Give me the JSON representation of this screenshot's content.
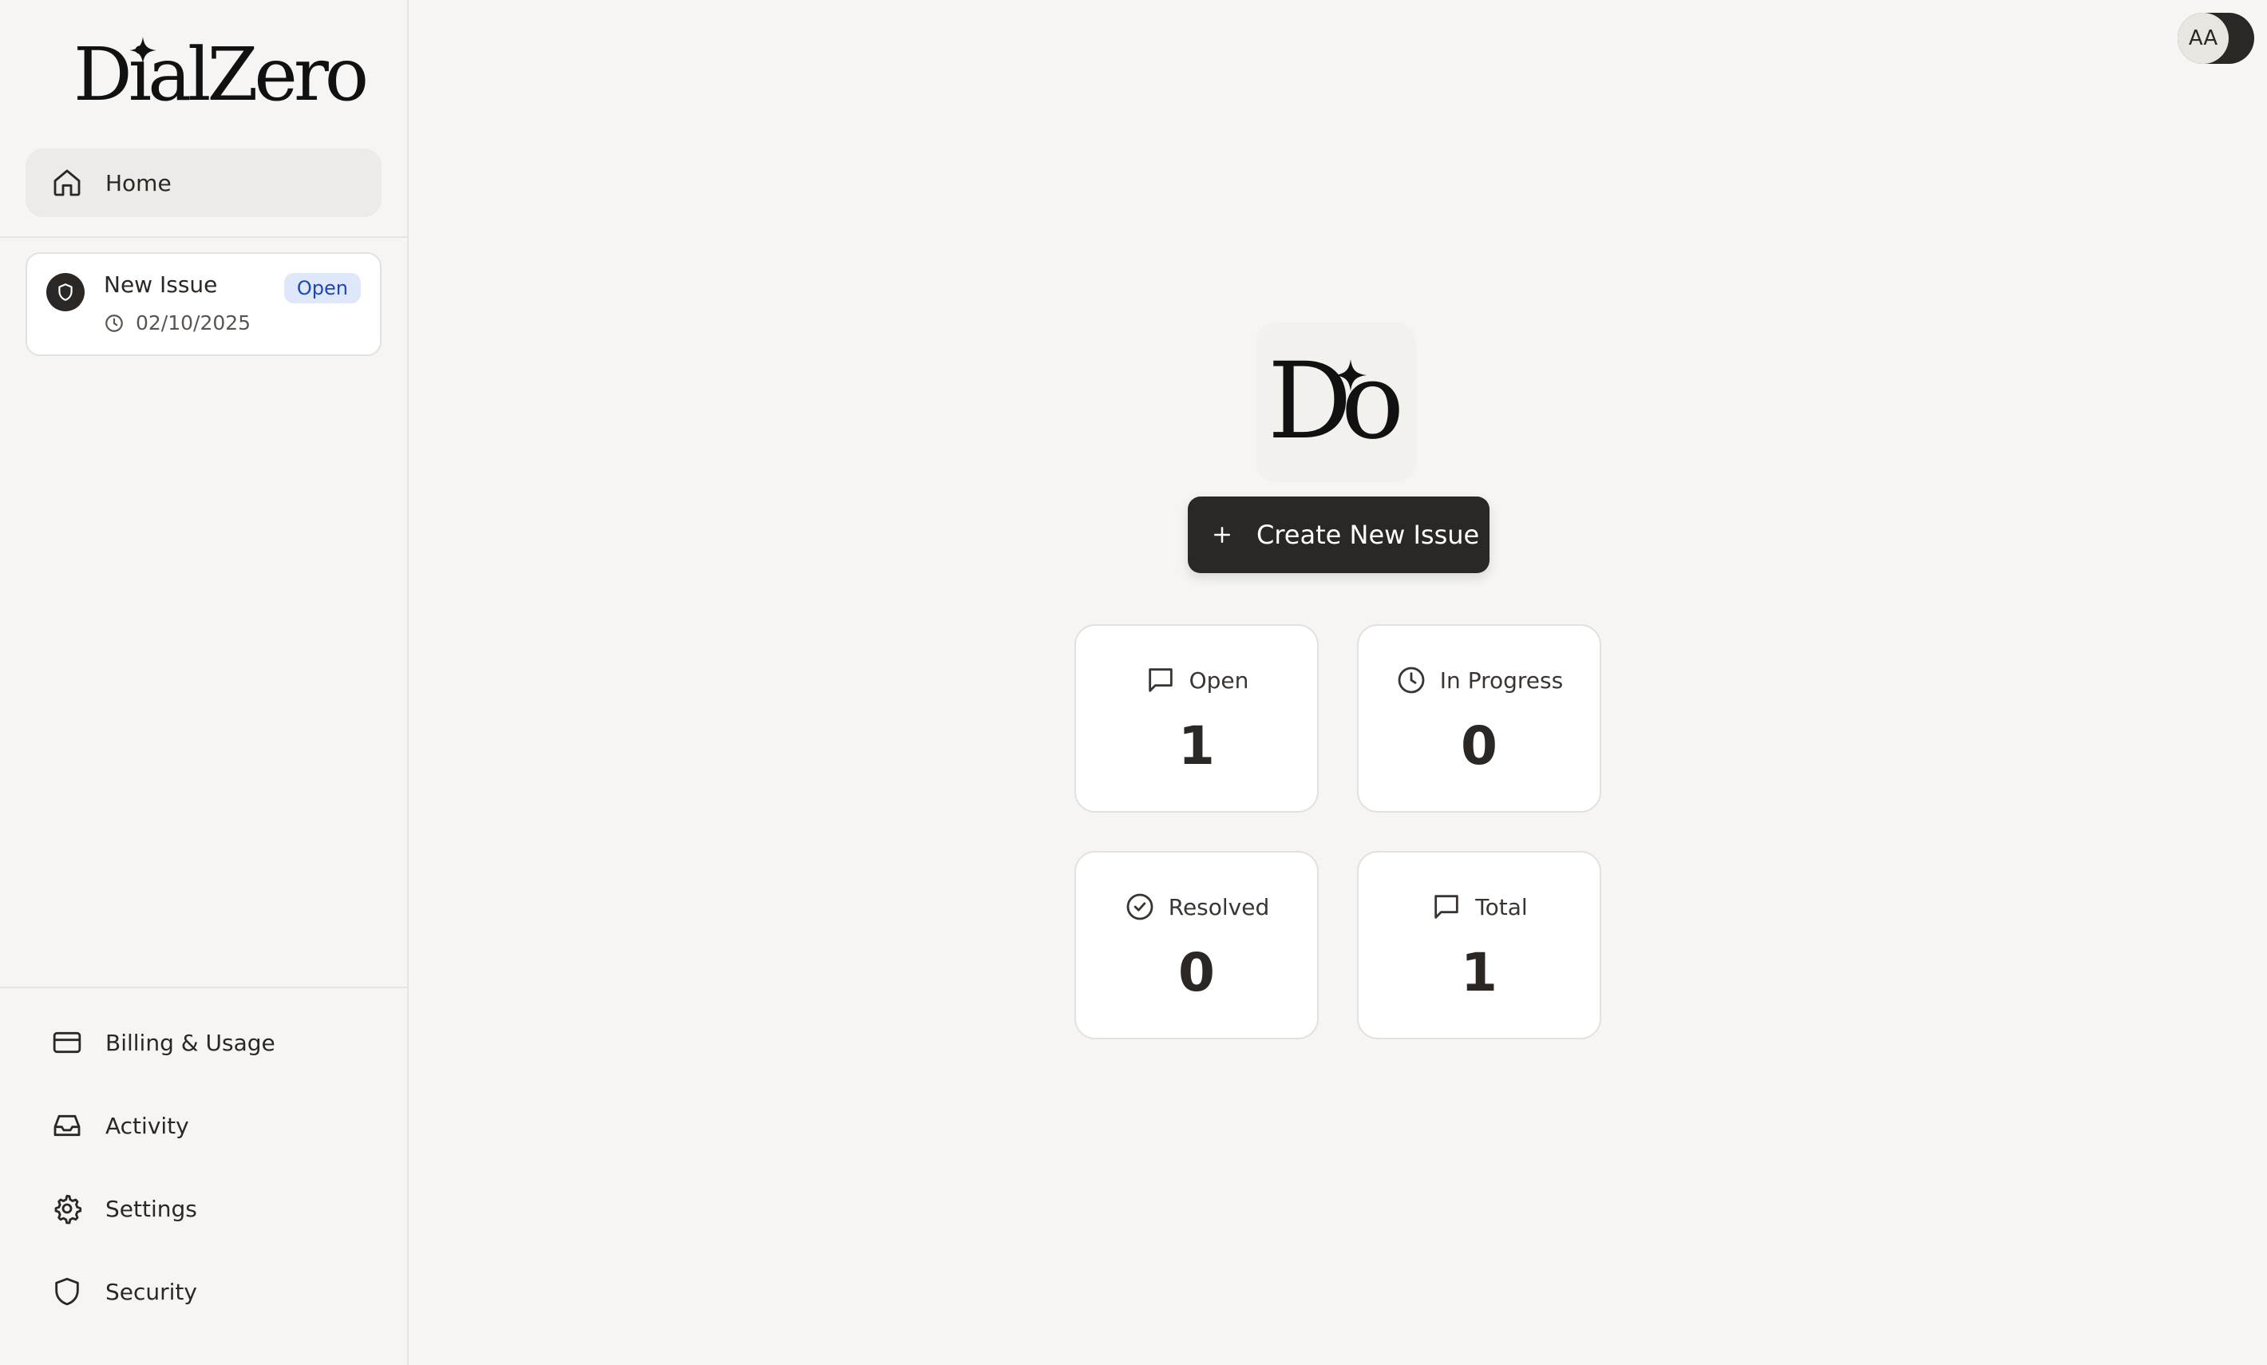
{
  "brand": {
    "name": "DialZero"
  },
  "sidebar": {
    "home": {
      "label": "Home",
      "icon": "home-icon"
    },
    "issues": [
      {
        "title": "New Issue",
        "status": "Open",
        "date": "02/10/2025"
      }
    ],
    "bottom_items": [
      {
        "label": "Billing & Usage",
        "icon": "credit-card-icon"
      },
      {
        "label": "Activity",
        "icon": "inbox-icon"
      },
      {
        "label": "Settings",
        "icon": "gear-icon"
      },
      {
        "label": "Security",
        "icon": "shield-icon"
      }
    ]
  },
  "header": {
    "user_initials": "AA"
  },
  "main": {
    "logo_text": "Do",
    "create_button": {
      "label": "Create New Issue"
    },
    "stats": [
      {
        "label": "Open",
        "value": "1",
        "icon": "message-square-icon"
      },
      {
        "label": "In Progress",
        "value": "0",
        "icon": "clock-icon"
      },
      {
        "label": "Resolved",
        "value": "0",
        "icon": "check-circle-icon"
      },
      {
        "label": "Total",
        "value": "1",
        "icon": "message-square-icon"
      }
    ]
  },
  "colors": {
    "background": "#f6f5f3",
    "dark": "#2b2724",
    "badge_bg": "#dfe8fb",
    "badge_text": "#1d46b8"
  }
}
